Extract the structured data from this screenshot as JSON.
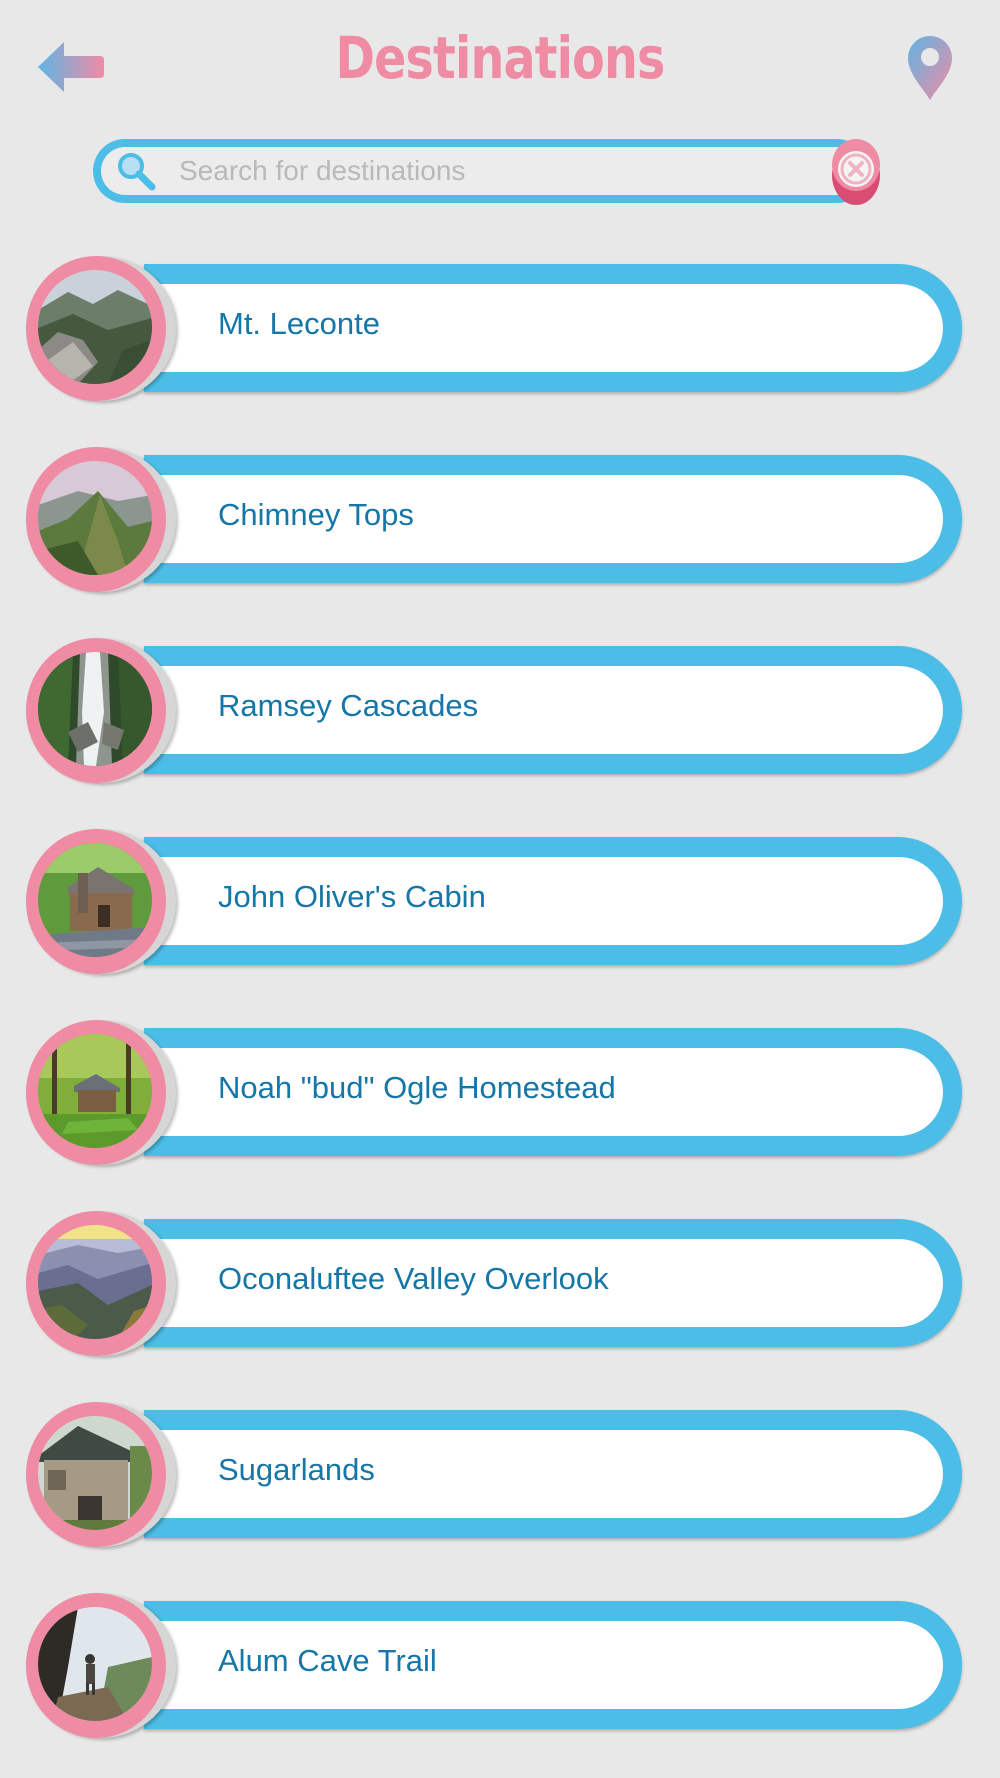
{
  "header": {
    "title": "Destinations",
    "back_icon": "back-arrow-icon",
    "map_icon": "map-pin-icon"
  },
  "search": {
    "placeholder": "Search for destinations",
    "value": "",
    "search_icon": "magnifier-icon",
    "clear_icon": "close-icon"
  },
  "colors": {
    "background": "#e8e8e8",
    "accent_blue": "#4bbde6",
    "accent_pink": "#f08ba4",
    "label_blue": "#1576a8"
  },
  "destinations": [
    {
      "label": "Mt. Leconte",
      "image": "rocky-mountain-ridge"
    },
    {
      "label": "Chimney Tops",
      "image": "green-mountain-peak"
    },
    {
      "label": "Ramsey Cascades",
      "image": "waterfall"
    },
    {
      "label": "John Oliver's Cabin",
      "image": "log-cabin"
    },
    {
      "label": "Noah \"bud\" Ogle Homestead",
      "image": "homestead-in-woods"
    },
    {
      "label": "Oconaluftee Valley Overlook",
      "image": "valley-overlook"
    },
    {
      "label": "Sugarlands",
      "image": "stone-visitor-center"
    },
    {
      "label": "Alum Cave Trail",
      "image": "cave-trail-hiker"
    }
  ]
}
